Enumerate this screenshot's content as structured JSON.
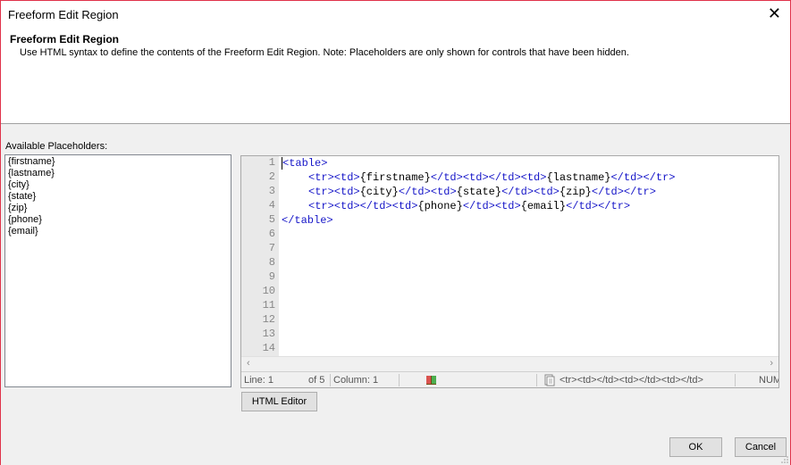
{
  "window": {
    "title": "Freeform Edit Region",
    "close_glyph": "✕"
  },
  "header": {
    "title": "Freeform Edit Region",
    "description": "Use HTML syntax to define the contents of the Freeform Edit Region. Note: Placeholders are only shown for controls that have been hidden."
  },
  "placeholders": {
    "label": "Available Placeholders:",
    "items": [
      "{firstname}",
      "{lastname}",
      "{city}",
      "{state}",
      "{zip}",
      "{phone}",
      "{email}"
    ]
  },
  "editor": {
    "line_numbers": [
      "1",
      "2",
      "3",
      "4",
      "5",
      "6",
      "7",
      "8",
      "9",
      "10",
      "11",
      "12",
      "13",
      "14"
    ],
    "code": {
      "l1_open": "<table>",
      "l2": {
        "a": "<tr><td>",
        "b": "{firstname}",
        "c": "</td><td></td><td>",
        "d": "{lastname}",
        "e": "</td></tr>"
      },
      "l3": {
        "a": "<tr><td>",
        "b": "{city}",
        "c": "</td><td>",
        "d": "{state}",
        "e": "</td><td>",
        "f": "{zip}",
        "g": "</td></tr>"
      },
      "l4": {
        "a": "<tr><td></td><td>",
        "b": "{phone}",
        "c": "</td><td>",
        "d": "{email}",
        "e": "</td></tr>"
      },
      "l5_close": "</table>"
    },
    "scroll_left_glyph": "‹",
    "scroll_right_glyph": "›"
  },
  "statusbar": {
    "line": "Line: 1",
    "of": "of 5",
    "column": "Column: 1",
    "breadcrumb": "<tr><td></td><td></td><td></td>",
    "num": "NUM",
    "icons": [
      "book-icon",
      "document-icon"
    ]
  },
  "buttons": {
    "html_editor": "HTML Editor",
    "ok": "OK",
    "cancel": "Cancel"
  },
  "colors": {
    "tag": "#1515c8",
    "window_border": "#e0324a",
    "panel_bg": "#f0f0f0"
  }
}
